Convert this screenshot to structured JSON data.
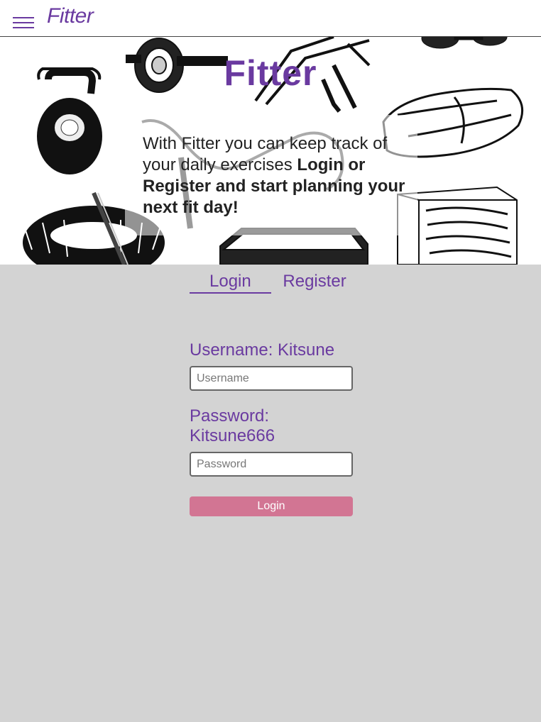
{
  "app": {
    "brand": "Fitter",
    "accent_color": "#6a3aa0",
    "button_color": "#d27593"
  },
  "hero": {
    "title": "Fitter",
    "text_plain": "With Fitter you can keep track of your daily exercises ",
    "text_bold": "Login or Register and start planning your next fit day!",
    "illustrations": [
      "ab-wheel",
      "suspension-straps",
      "dumbbells",
      "kettlebell",
      "sandbag",
      "tire-with-hammer",
      "step-platform",
      "plyo-box",
      "jump-rope"
    ]
  },
  "tabs": {
    "login": "Login",
    "register": "Register",
    "active": "login"
  },
  "form": {
    "username_label": "Username: Kitsune",
    "username_placeholder": "Username",
    "password_label_line1": "Password:",
    "password_label_line2": "Kitsune666",
    "password_placeholder": "Password",
    "submit_label": "Login"
  },
  "icons": {
    "menu": "hamburger-menu-icon"
  }
}
